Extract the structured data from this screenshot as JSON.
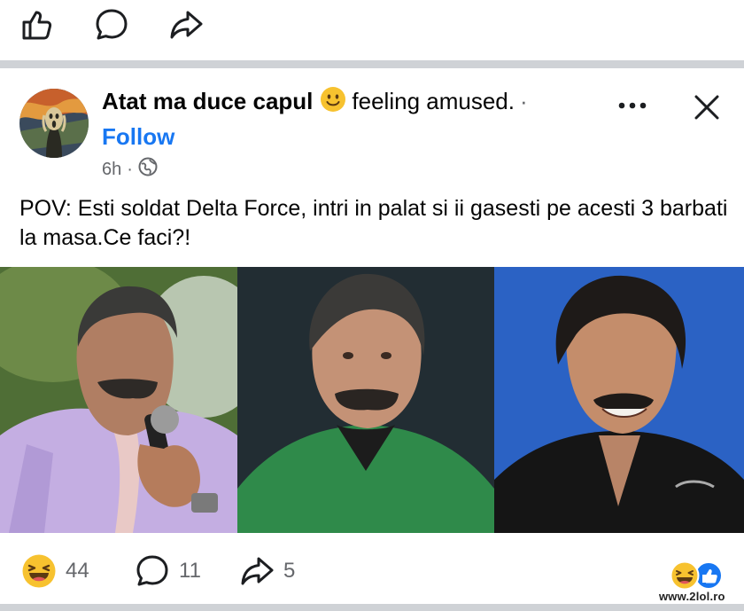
{
  "post": {
    "author": "Atat ma duce capul",
    "feeling": "feeling amused.",
    "separator": "·",
    "follow_label": "Follow",
    "time": "6h",
    "meta_separator": "·",
    "privacy_icon": "globe-icon",
    "text": "POV: Esti soldat Delta Force, intri in palat si ii gasesti pe acesti 3 barbati la masa.Ce faci?!",
    "photos_count": 3
  },
  "stats": {
    "reactions": "44",
    "comments": "11",
    "shares": "5"
  },
  "watermark": "www.2lol.ro",
  "colors": {
    "accent": "#1877f2",
    "text": "#050505",
    "muted": "#65676b",
    "divider": "#cfd2d6",
    "emoji_yellow": "#f7b928"
  }
}
